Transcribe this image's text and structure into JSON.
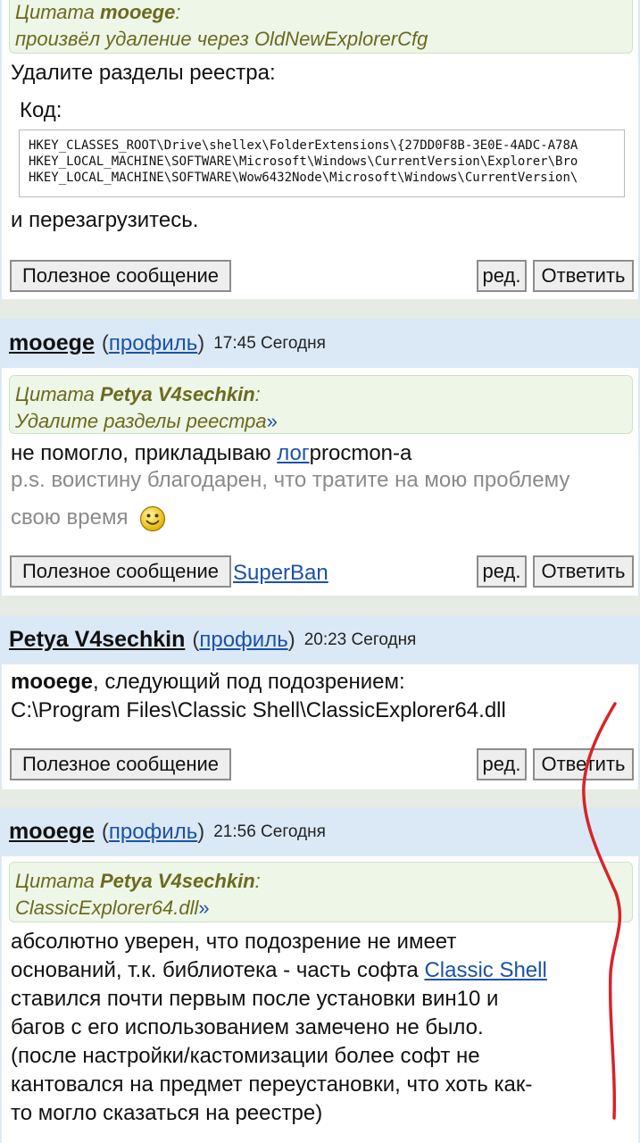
{
  "post1": {
    "quote_prefix": "Цитата",
    "quote_author": "mooege",
    "quote_suffix": ":",
    "quote_text": "произвёл удаление через OldNewExplorerCfg",
    "text1": "Удалите разделы реестра:",
    "code_label": "Код:",
    "code_lines": [
      "HKEY_CLASSES_ROOT\\Drive\\shellex\\FolderExtensions\\{27DD0F8B-3E0E-4ADC-A78A",
      "HKEY_LOCAL_MACHINE\\SOFTWARE\\Microsoft\\Windows\\CurrentVersion\\Explorer\\Bro",
      "HKEY_LOCAL_MACHINE\\SOFTWARE\\Wow6432Node\\Microsoft\\Windows\\CurrentVersion\\"
    ],
    "text2": "и перезагрузитесь.",
    "btn_useful": "Полезное сообщение",
    "btn_edit": "ред.",
    "btn_reply": "Ответить"
  },
  "post2": {
    "author": "mooege",
    "paren_open": "(",
    "profile": "профиль",
    "paren_close": ")",
    "time": "17:45 Сегодня",
    "quote_prefix": "Цитата",
    "quote_author": "Petya V4sechkin",
    "quote_suffix": ":",
    "quote_text": "Удалите разделы реестра",
    "quote_arrow": "»",
    "text_before_link": "не помогло, прикладываю ",
    "link": "лог",
    "text_after_link": "procmon-а",
    "ps_line1": "p.s. воистину благодарен, что тратите на мою проблему",
    "ps_line2": "свою время",
    "btn_useful": "Полезное сообщение",
    "superban": "SuperBan",
    "btn_edit": "ред.",
    "btn_reply": "Ответить"
  },
  "post3": {
    "author": "Petya V4sechkin",
    "paren_open": "(",
    "profile": "профиль",
    "paren_close": ")",
    "time": "20:23 Сегодня",
    "bold_name": "mooege",
    "text1": ", следующий под подозрением:",
    "text2": "C:\\Program Files\\Classic Shell\\ClassicExplorer64.dll",
    "btn_useful": "Полезное сообщение",
    "btn_edit": "ред.",
    "btn_reply": "Ответить"
  },
  "post4": {
    "author": "mooege",
    "paren_open": "(",
    "profile": "профиль",
    "paren_close": ")",
    "time": "21:56 Сегодня",
    "quote_prefix": "Цитата",
    "quote_author": "Petya V4sechkin",
    "quote_suffix": ":",
    "quote_text": "ClassicExplorer64.dll",
    "quote_arrow": "»",
    "line1": "абсолютно уверен, что подозрение не имеет",
    "line2_before_link": "оснований, т.к. библиотека - часть софта ",
    "line2_link": "Classic Shell",
    "line3": "ставился почти первым после установки вин10 и",
    "line4": "багов с его использованием замечено не было.",
    "line5": "(после настройки/кастомизации более софт не",
    "line6": "кантовался на предмет переустановки, что хоть как-",
    "line7": "то могло сказаться на реестре)"
  },
  "colors": {
    "header_bg": "#dbe9f6",
    "quote_bg": "#eef6e8",
    "quote_text": "#6b6a1e",
    "link": "#1a52a8",
    "annotation_line": "#d8232a"
  }
}
